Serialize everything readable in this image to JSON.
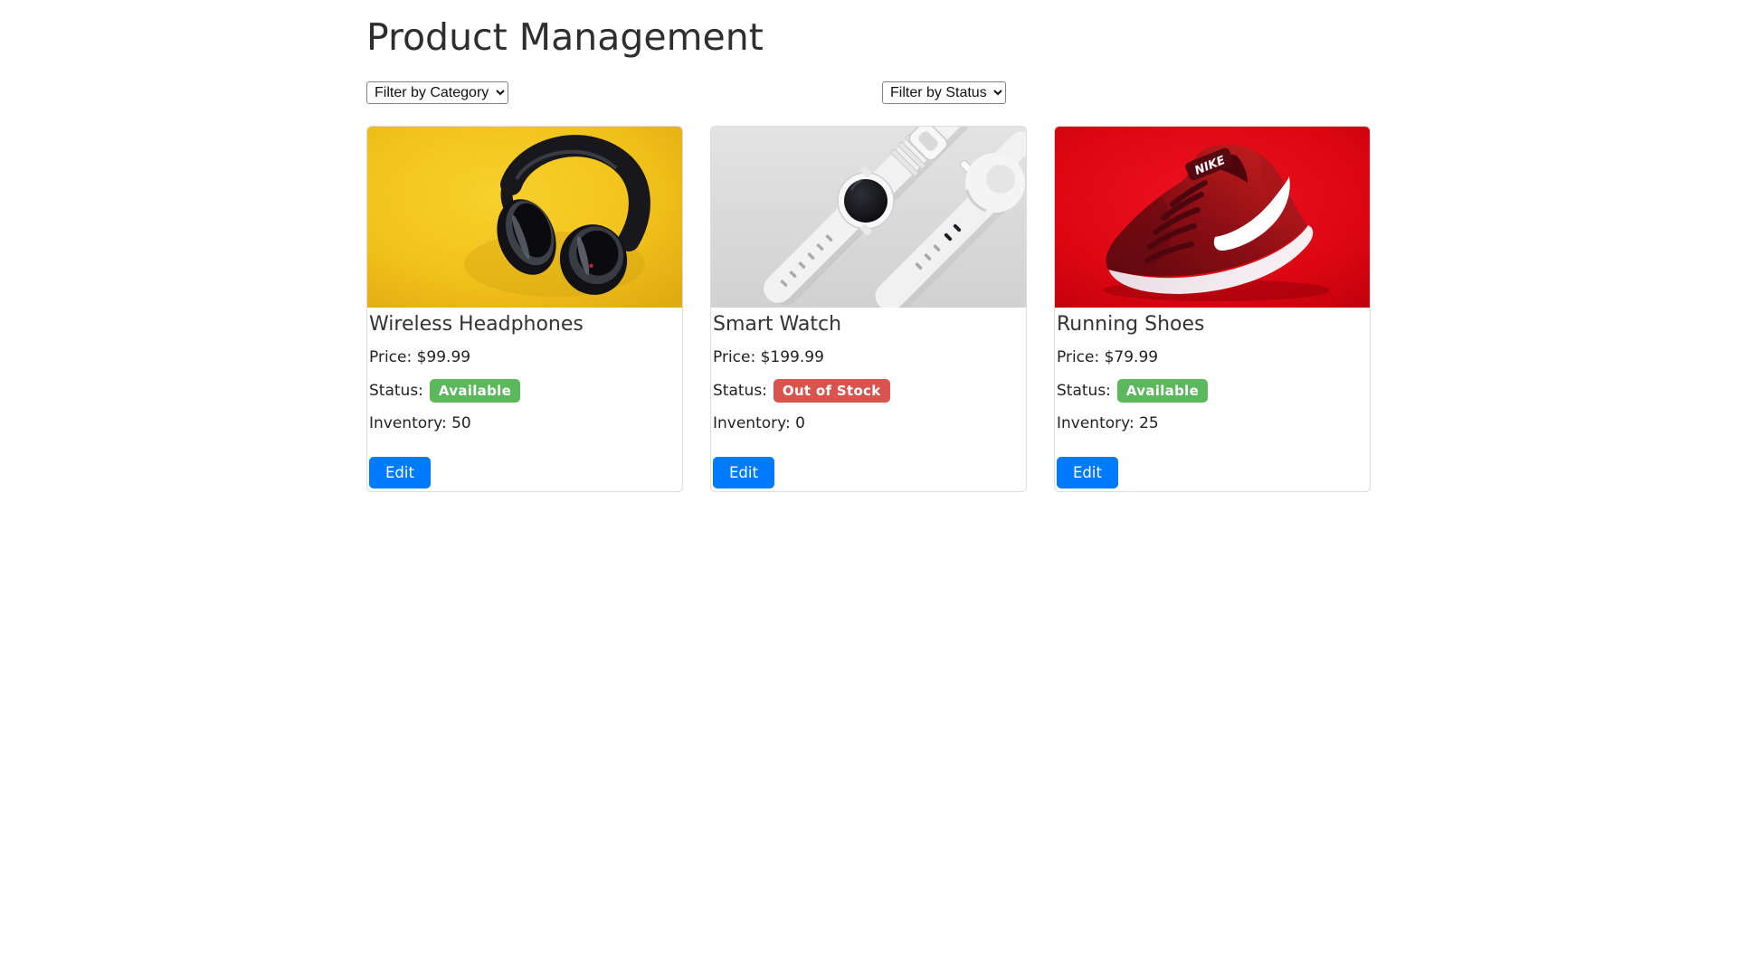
{
  "page": {
    "title": "Product Management"
  },
  "filters": {
    "category": {
      "selected_option": "Filter by Category"
    },
    "status": {
      "selected_option": "Filter by Status"
    }
  },
  "field_labels": {
    "price": "Price:",
    "status": "Status:",
    "inventory": "Inventory:"
  },
  "products": [
    {
      "name": "Wireless Headphones",
      "price": "$99.99",
      "status": "Available",
      "status_class": "badge-available",
      "inventory": "50",
      "edit_label": "Edit",
      "image": "black-wireless-headphones-on-yellow-background"
    },
    {
      "name": "Smart Watch",
      "price": "$199.99",
      "status": "Out of Stock",
      "status_class": "badge-out-of-stock",
      "inventory": "0",
      "edit_label": "Edit",
      "image": "two-white-smart-watches-on-gray-background"
    },
    {
      "name": "Running Shoes",
      "price": "$79.99",
      "status": "Available",
      "status_class": "badge-available",
      "inventory": "25",
      "edit_label": "Edit",
      "image": "red-nike-running-shoe-on-red-background",
      "image_brand": "NIKE"
    }
  ],
  "colors": {
    "status_available": "#5cb85c",
    "status_out_of_stock": "#d9534f",
    "edit_button": "#007bff",
    "card_border": "#dddddd",
    "title_text": "#2e2e2e"
  }
}
